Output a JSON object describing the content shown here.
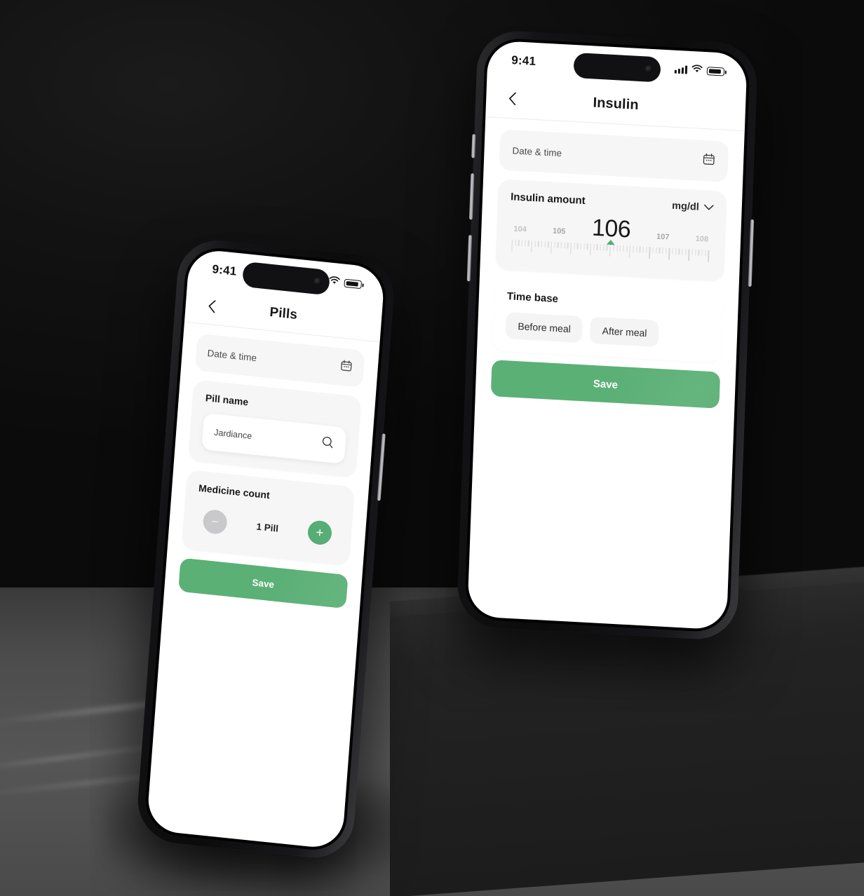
{
  "scene": {
    "background_color": "#0d0d0d",
    "floor_color": "#565656",
    "accent_green": "#5bb076"
  },
  "phones": [
    {
      "id": "insulin",
      "status_bar": {
        "time": "9:41",
        "signal_icon": "signal-bars-icon",
        "wifi_icon": "wifi-icon",
        "battery_icon": "battery-icon"
      },
      "nav": {
        "back_icon": "chevron-left-icon",
        "title": "Insulin"
      },
      "date_time": {
        "label": "Date & time",
        "icon": "calendar-icon"
      },
      "insulin_amount": {
        "title": "Insulin amount",
        "unit": "mg/dl",
        "unit_chevron_icon": "chevron-down-icon",
        "ticks": [
          "104",
          "105",
          "106",
          "107",
          "108"
        ],
        "selected": "106",
        "caret_icon": "ruler-caret-icon"
      },
      "time_base": {
        "title": "Time base",
        "options": [
          "Before meal",
          "After meal"
        ]
      },
      "save_label": "Save"
    },
    {
      "id": "pills",
      "status_bar": {
        "time": "9:41",
        "signal_icon": "signal-bars-icon",
        "wifi_icon": "wifi-icon",
        "battery_icon": "battery-icon"
      },
      "nav": {
        "back_icon": "chevron-left-icon",
        "title": "Pills"
      },
      "date_time": {
        "label": "Date & time",
        "icon": "calendar-icon"
      },
      "pill_name": {
        "title": "Pill name",
        "value": "Jardiance",
        "search_icon": "search-icon"
      },
      "medicine_count": {
        "title": "Medicine count",
        "value": "1 Pill",
        "decrement_label": "−",
        "increment_label": "+"
      },
      "save_label": "Save"
    }
  ]
}
